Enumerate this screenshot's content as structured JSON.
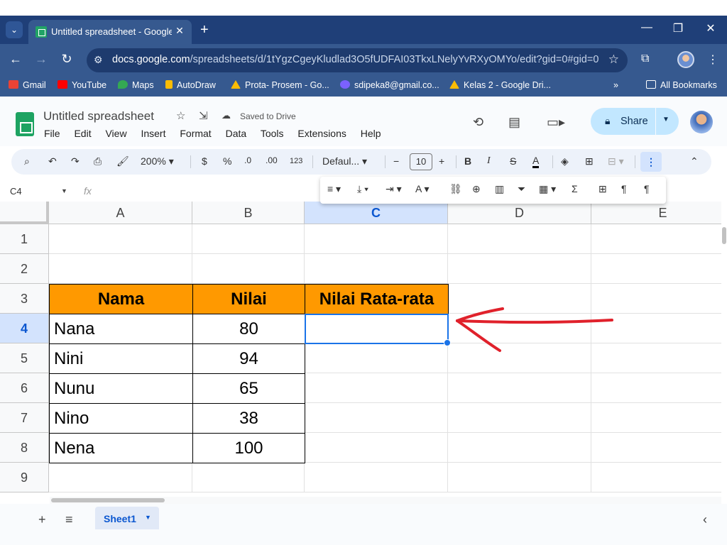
{
  "browser": {
    "tab_title": "Untitled spreadsheet - Google S",
    "url_host": "docs.google.com",
    "url_path": "/spreadsheets/d/1tYgzCgeyKludlad3O5fUDFAI03TkxLNelyYvRXyOMYo/edit?gid=0#gid=0",
    "bookmarks": [
      "Gmail",
      "YouTube",
      "Maps",
      "AutoDraw",
      "Prota- Prosem - Go...",
      "sdipeka8@gmail.co...",
      "Kelas 2 - Google Dri..."
    ],
    "all_bookmarks": "All Bookmarks"
  },
  "doc": {
    "title": "Untitled spreadsheet",
    "saved_status": "Saved to Drive",
    "menu": [
      "File",
      "Edit",
      "View",
      "Insert",
      "Format",
      "Data",
      "Tools",
      "Extensions",
      "Help"
    ],
    "share_label": "Share"
  },
  "toolbar": {
    "zoom": "200%",
    "currency": "$",
    "percent": "%",
    "dec_decrease": ".0",
    "dec_increase": ".00",
    "number_format": "123",
    "font": "Defaul...",
    "font_size": "10"
  },
  "formula_bar": {
    "name_box": "C4",
    "fx": "fx",
    "value": ""
  },
  "sheet": {
    "columns": [
      "A",
      "B",
      "C",
      "D",
      "E"
    ],
    "rows": [
      "1",
      "2",
      "3",
      "4",
      "5",
      "6",
      "7",
      "8",
      "9"
    ],
    "selected_cell": "C4",
    "table_header": [
      "Nama",
      "Nilai",
      "Nilai Rata-rata"
    ],
    "table_rows": [
      {
        "nama": "Nana",
        "nilai": "80",
        "rata": ""
      },
      {
        "nama": "Nini",
        "nilai": "94",
        "rata": ""
      },
      {
        "nama": "Nunu",
        "nilai": "65",
        "rata": ""
      },
      {
        "nama": "Nino",
        "nilai": "38",
        "rata": ""
      },
      {
        "nama": "Nena",
        "nilai": "100",
        "rata": ""
      }
    ],
    "header_color": "#ff9900",
    "tabs": [
      "Sheet1"
    ]
  },
  "annotation": {
    "arrow_color": "#e0212b"
  }
}
